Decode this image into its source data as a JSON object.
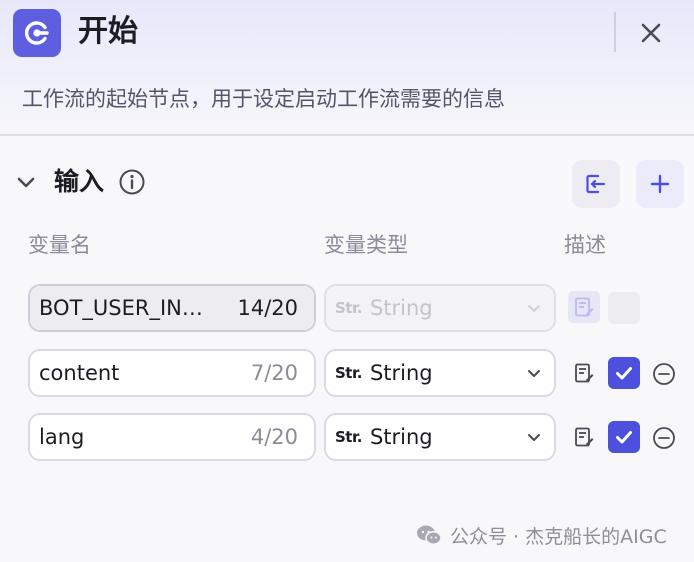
{
  "header": {
    "title": "开始",
    "description": "工作流的起始节点，用于设定启动工作流需要的信息"
  },
  "section": {
    "title": "输入"
  },
  "columns": {
    "name": "变量名",
    "type": "变量类型",
    "description": "描述"
  },
  "rows": [
    {
      "name": "BOT_USER_IN…",
      "count": "14/20",
      "type_prefix": "Str.",
      "type": "String",
      "required": false,
      "disabled": true
    },
    {
      "name": "content",
      "count": "7/20",
      "type_prefix": "Str.",
      "type": "String",
      "required": true,
      "disabled": false
    },
    {
      "name": "lang",
      "count": "4/20",
      "type_prefix": "Str.",
      "type": "String",
      "required": true,
      "disabled": false
    }
  ],
  "watermark": {
    "text": "公众号 · 杰克船长的AIGC"
  },
  "colors": {
    "accent": "#4d50dc",
    "app_icon": "#5e5ee0"
  }
}
